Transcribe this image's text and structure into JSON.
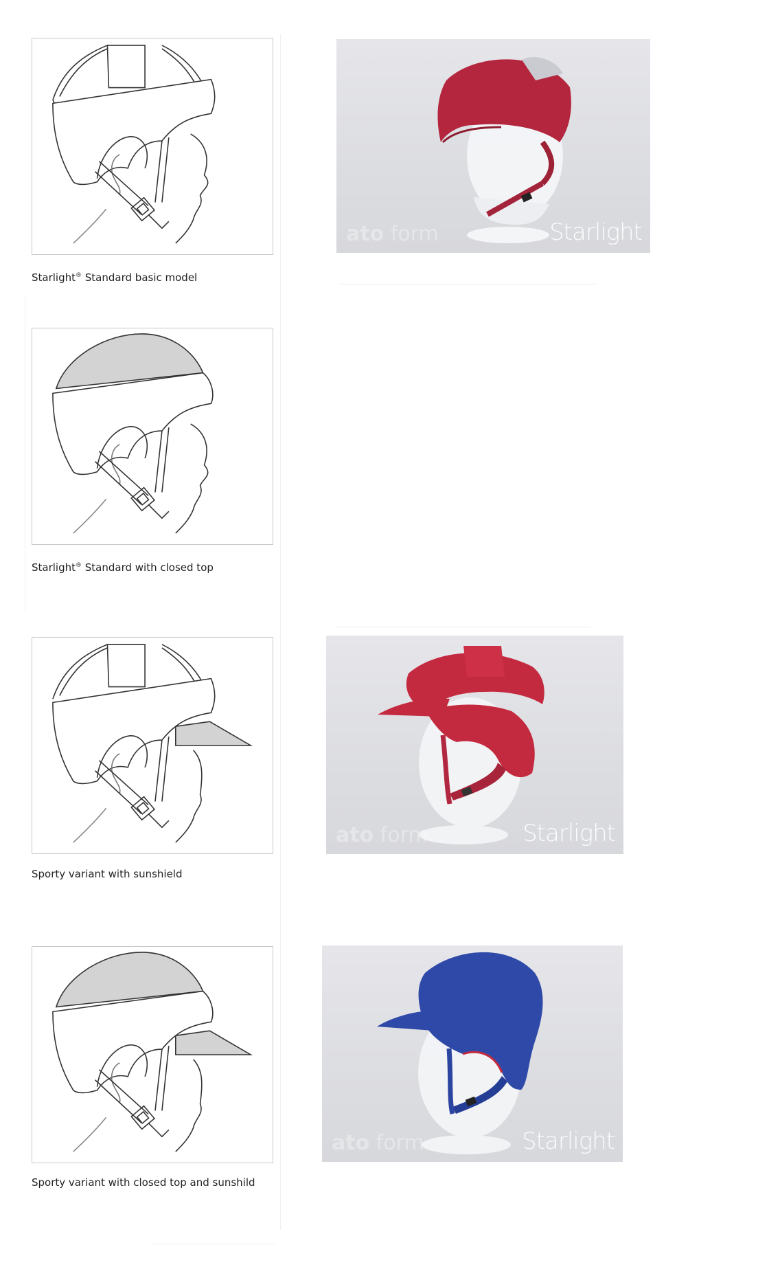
{
  "items": [
    {
      "caption_main": "Starlight",
      "caption_sup": "®",
      "caption_rest": " Standard basic model",
      "photo_brand": "Starlight",
      "photo_watermark_a": "ato",
      "photo_watermark_b": " form",
      "variant": "open-top",
      "color": "#b3263e"
    },
    {
      "caption_main": "Starlight",
      "caption_sup": "®",
      "caption_rest": " Standard with closed top",
      "variant": "closed-top"
    },
    {
      "caption_main": "Sporty variant with sunshield",
      "caption_sup": "",
      "caption_rest": "",
      "photo_brand": "Starlight",
      "photo_watermark_a": "ato",
      "photo_watermark_b": " form",
      "variant": "open-top-visor",
      "color": "#c42a3f"
    },
    {
      "caption_main": "Sporty variant with closed top and sunshild",
      "caption_sup": "",
      "caption_rest": "",
      "photo_brand": "Starlight",
      "photo_watermark_a": "ato",
      "photo_watermark_b": " form",
      "variant": "closed-top-visor",
      "color": "#2e49a8"
    }
  ]
}
